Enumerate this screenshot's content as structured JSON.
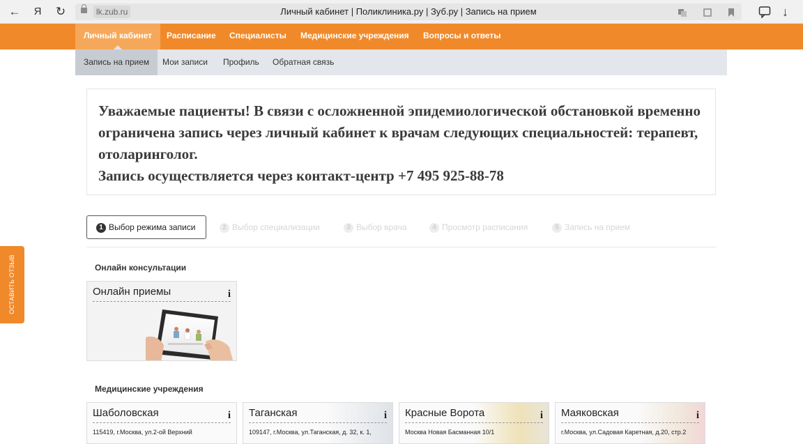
{
  "browser": {
    "back_icon": "←",
    "yandex_icon": "Я",
    "reload_icon": "↻",
    "host": "lk.zub.ru",
    "title": "Личный кабинет | Поликлиника.ру | Зуб.ру | Запись на прием",
    "download_icon": "↓"
  },
  "nav": {
    "main": [
      {
        "label": "Личный кабинет"
      },
      {
        "label": "Расписание"
      },
      {
        "label": "Специалисты"
      },
      {
        "label": "Медицинские учреждения"
      },
      {
        "label": "Вопросы и ответы"
      }
    ],
    "sub": [
      {
        "label": "Запись на прием"
      },
      {
        "label": "Мои записи"
      },
      {
        "label": "Профиль"
      },
      {
        "label": "Обратная связь"
      }
    ]
  },
  "notice": {
    "line1": "Уважаемые пациенты! В связи с осложненной эпидемиологической обстановкой временно ограничена запись через личный кабинет к врачам следующих специальностей: терапевт, отоларинголог.",
    "line2": "Запись осуществляется через контакт-центр +7 495 925-88-78"
  },
  "steps": [
    {
      "num": "1",
      "label": "Выбор режима записи"
    },
    {
      "num": "2",
      "label": "Выбор специализации"
    },
    {
      "num": "3",
      "label": "Выбор врача"
    },
    {
      "num": "4",
      "label": "Просмотр расписания"
    },
    {
      "num": "5",
      "label": "Запись на прием"
    }
  ],
  "online": {
    "section_title": "Онлайн консультации",
    "tile_title": "Онлайн приемы",
    "info": "i"
  },
  "clinics": {
    "section_title": "Медицинские учреждения",
    "items": [
      {
        "name": "Шаболовская",
        "address": "115419, г.Москва, ул.2-ой Верхний",
        "info": "i"
      },
      {
        "name": "Таганская",
        "address": "109147, г.Москва, ул.Таганская, д. 32, к. 1,",
        "info": "i"
      },
      {
        "name": "Красные Ворота",
        "address": "Москва Новая Басманная 10/1",
        "info": "i"
      },
      {
        "name": "Маяковская",
        "address": "г.Москва, ул.Садовая Каретная, д.20, стр.2",
        "info": "i"
      }
    ]
  },
  "feedback": {
    "label": "ОСТАВИТЬ ОТЗЫВ"
  },
  "colors": {
    "brand": "#f0892a",
    "sub_nav": "#e3e6ea"
  }
}
